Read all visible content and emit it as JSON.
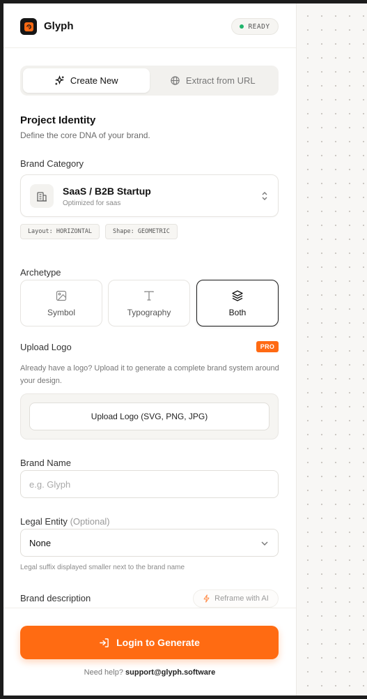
{
  "app": {
    "name": "Glyph",
    "status": "READY"
  },
  "tabs": [
    {
      "label": "Create New",
      "icon": "sparkles-icon"
    },
    {
      "label": "Extract from URL",
      "icon": "globe-icon"
    }
  ],
  "identity": {
    "title": "Project Identity",
    "subtitle": "Define the core DNA of your brand."
  },
  "category": {
    "label": "Brand Category",
    "selected": "SaaS / B2B Startup",
    "subtitle": "Optimized for saas",
    "icon": "building-icon",
    "tags": [
      "Layout: HORIZONTAL",
      "Shape: GEOMETRIC"
    ]
  },
  "archetype": {
    "label": "Archetype",
    "options": [
      {
        "label": "Symbol",
        "icon": "image-icon"
      },
      {
        "label": "Typography",
        "icon": "type-icon"
      },
      {
        "label": "Both",
        "icon": "layers-icon"
      }
    ],
    "selected": "Both"
  },
  "upload": {
    "label": "Upload Logo",
    "badge": "PRO",
    "description": "Already have a logo? Upload it to generate a complete brand system around your design.",
    "button": "Upload Logo (SVG, PNG, JPG)"
  },
  "brand_name": {
    "label": "Brand Name",
    "placeholder": "e.g. Glyph",
    "value": ""
  },
  "legal_entity": {
    "label": "Legal Entity",
    "optional": "(Optional)",
    "value": "None",
    "hint": "Legal suffix displayed smaller next to the brand name"
  },
  "description": {
    "label": "Brand description",
    "reframe": "Reframe with AI"
  },
  "footer": {
    "cta": "Login to Generate",
    "help_prefix": "Need help?",
    "help_email": "support@glyph.software"
  },
  "colors": {
    "accent": "#ff6b12",
    "ready": "#1fb46b",
    "dark": "#161616"
  }
}
